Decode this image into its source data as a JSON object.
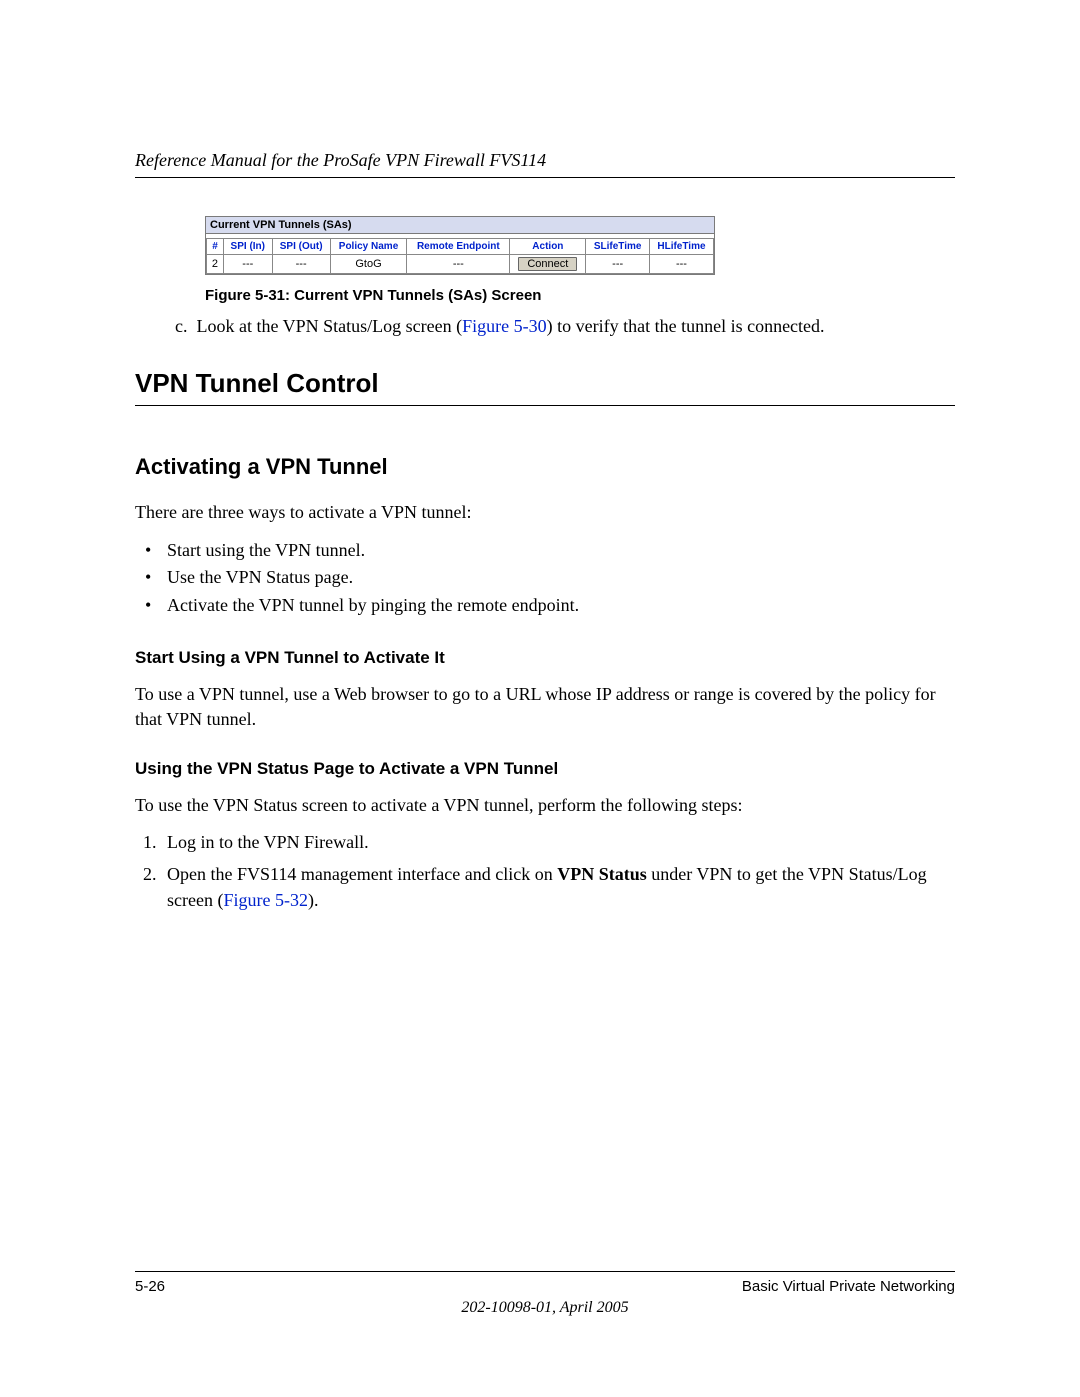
{
  "header": {
    "title": "Reference Manual for the ProSafe VPN Firewall FVS114"
  },
  "screenshot": {
    "title": "Current VPN Tunnels (SAs)",
    "headers": [
      "#",
      "SPI (In)",
      "SPI (Out)",
      "Policy Name",
      "Remote Endpoint",
      "Action",
      "SLifeTime",
      "HLifeTime"
    ],
    "row": {
      "num": "2",
      "spi_in": "---",
      "spi_out": "---",
      "policy": "GtoG",
      "remote": "---",
      "action": "Connect",
      "slife": "---",
      "hlife": "---"
    }
  },
  "figure": {
    "caption": "Figure 5-31:  Current VPN Tunnels (SAs) Screen"
  },
  "step_c": {
    "label": "c.",
    "pre": "Look at the VPN Status/Log screen (",
    "link": "Figure 5-30",
    "post": ") to verify that the tunnel is connected."
  },
  "h1": "VPN Tunnel Control",
  "h2": "Activating a VPN Tunnel",
  "intro": "There are three ways to activate a VPN tunnel:",
  "bullets": [
    "Start using the VPN tunnel.",
    "Use the VPN Status page.",
    "Activate the VPN tunnel by pinging the remote endpoint."
  ],
  "sec1": {
    "title": "Start Using a VPN Tunnel to Activate It",
    "body": "To use a VPN tunnel, use a Web browser to go to a URL whose IP address or range is covered by the policy for that VPN tunnel."
  },
  "sec2": {
    "title": "Using the VPN Status Page to Activate a VPN Tunnel",
    "intro": "To use the VPN Status screen to activate a VPN tunnel, perform the following steps:",
    "steps": {
      "s1": "Log in to the VPN Firewall.",
      "s2_pre": "Open the FVS114 management interface and click on ",
      "s2_bold": "VPN Status",
      "s2_mid": " under VPN to get the VPN Status/Log screen (",
      "s2_link": "Figure 5-32",
      "s2_post": ")."
    }
  },
  "footer": {
    "left": "5-26",
    "right": "Basic Virtual Private Networking",
    "center": "202-10098-01, April 2005"
  }
}
